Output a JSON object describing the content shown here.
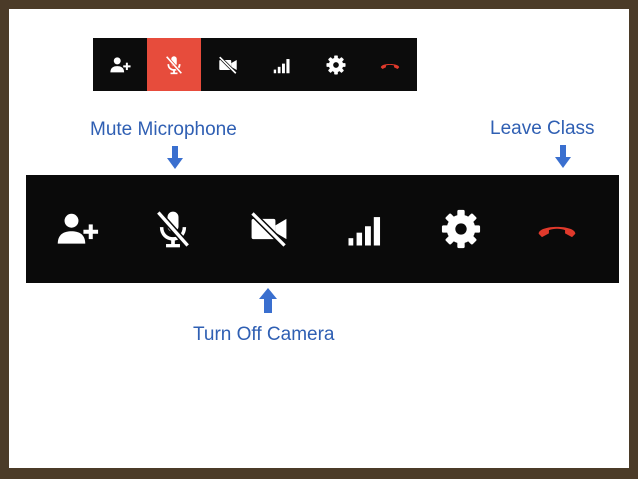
{
  "annotations": {
    "mute_microphone": "Mute Microphone",
    "leave_class": "Leave Class",
    "turn_off_camera": "Turn Off Camera"
  },
  "icons": [
    "add-person-icon",
    "microphone-off-icon",
    "camera-off-icon",
    "signal-icon",
    "gear-icon",
    "hang-up-icon"
  ],
  "colors": {
    "frame": "#4b3b28",
    "toolbar": "#0a0a0a",
    "active_button": "#e74c3c",
    "hang_up": "#e0392b",
    "label_text": "#2f5fb3",
    "arrow": "#3a6fcf"
  }
}
